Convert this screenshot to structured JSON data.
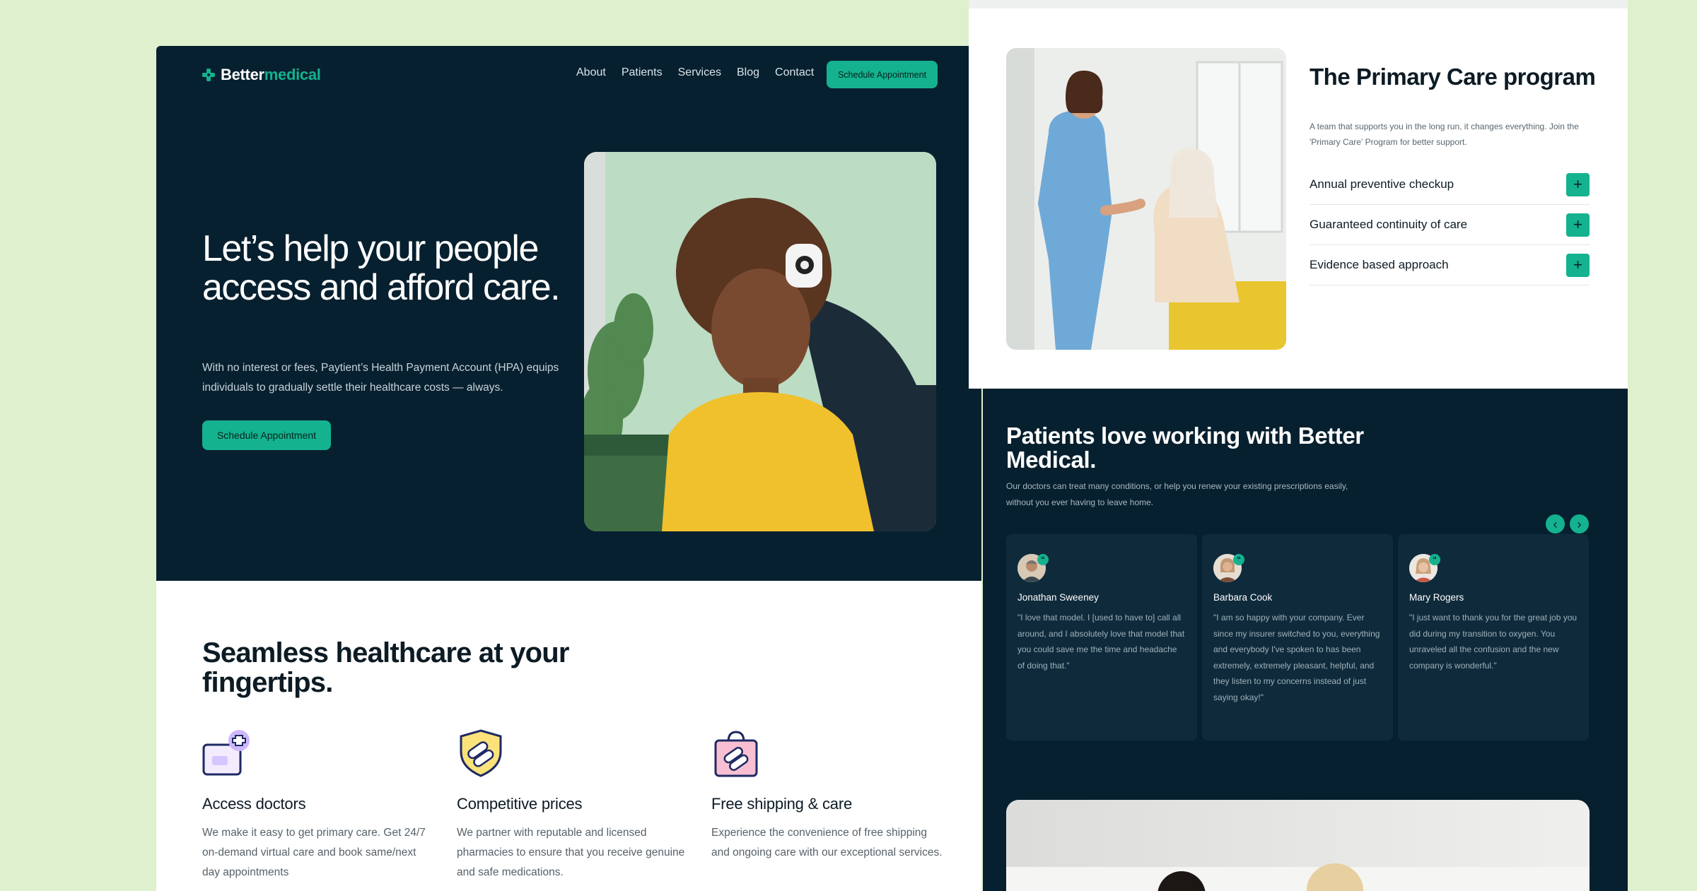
{
  "brand": {
    "name_part1": "Better",
    "name_part2": "medical",
    "accent_color": "#14B28F",
    "dark_color": "#07202F"
  },
  "nav": {
    "items": [
      "About",
      "Patients",
      "Services",
      "Blog",
      "Contact"
    ],
    "cta": "Schedule Appointment"
  },
  "hero": {
    "title": "Let’s help your people access and afford care.",
    "subtitle": "With no interest or fees, Paytient’s Health Payment Account (HPA) equips individuals to gradually settle their healthcare costs — always.",
    "cta": "Schedule Appointment"
  },
  "seamless": {
    "title": "Seamless healthcare at your fingertips.",
    "features": [
      {
        "icon": "doctor-plus-icon",
        "title": "Access doctors",
        "text": "We make it easy to get primary care. Get 24/7 on-demand virtual care and book same/next day appointments"
      },
      {
        "icon": "shield-pills-icon",
        "title": "Competitive prices",
        "text": "We partner with reputable and licensed pharmacies to ensure that you receive genuine and safe medications."
      },
      {
        "icon": "shopping-bag-pills-icon",
        "title": "Free shipping & care",
        "text": "Experience the convenience of free shipping and ongoing care with our exceptional services."
      }
    ]
  },
  "primary_care": {
    "title": "The Primary Care program",
    "subtitle": "A team that supports you in the long run, it changes everything. Join the 'Primary Care' Program for better support.",
    "items": [
      "Annual preventive checkup",
      "Guaranteed continuity of care",
      "Evidence based approach"
    ],
    "plus_symbol": "+"
  },
  "testimonials": {
    "title": "Patients love working with Better Medical.",
    "subtitle": "Our doctors can treat many conditions, or help you renew your existing prescriptions easily, without you ever having to leave home.",
    "prev_arrow": "‹",
    "next_arrow": "›",
    "quote_mark": "“",
    "cards": [
      {
        "name": "Jonathan Sweeney",
        "quote": "\"I love that model. I [used to have to] call all around, and I absolutely love that model that you could save me the time and headache of doing that.\""
      },
      {
        "name": "Barbara Cook",
        "quote": "\"I am so happy with your company. Ever since my insurer switched to you, everything and everybody I've spoken to has been extremely, extremely pleasant, helpful, and they listen to my concerns instead of just saying okay!\""
      },
      {
        "name": "Mary Rogers",
        "quote": "\"I just want to thank you for the great job you did during my transition to oxygen. You unraveled all the confusion and the new company is wonderful.\""
      }
    ]
  }
}
